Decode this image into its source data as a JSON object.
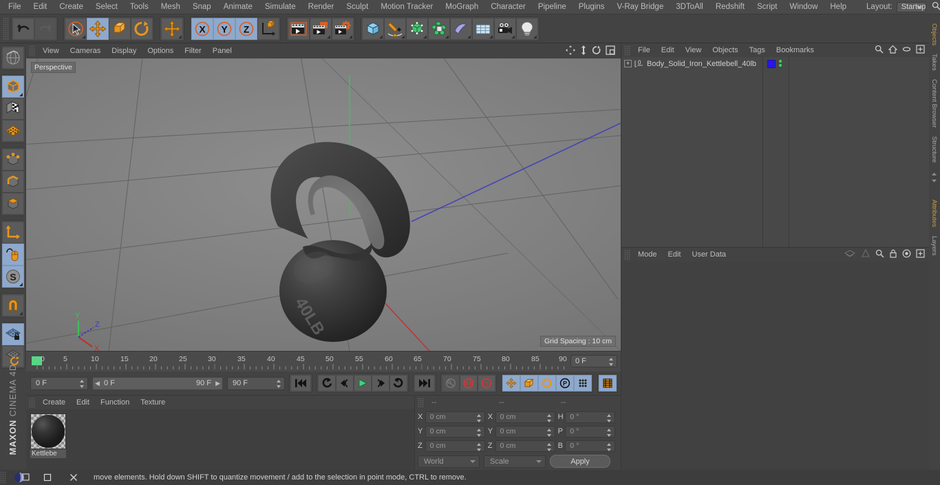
{
  "menubar": {
    "items": [
      "File",
      "Edit",
      "Create",
      "Select",
      "Tools",
      "Mesh",
      "Snap",
      "Animate",
      "Simulate",
      "Render",
      "Sculpt",
      "Motion Tracker",
      "MoGraph",
      "Character",
      "Pipeline",
      "Plugins",
      "V-Ray Bridge",
      "3DToAll",
      "Redshift",
      "Script",
      "Window",
      "Help"
    ],
    "layout_label": "Layout:",
    "layout_value": "Startup",
    "search_icon": "search-icon"
  },
  "toolbar": {
    "undo": "undo-icon",
    "redo": "redo-icon",
    "live_selection": "live-selection-icon",
    "move": "move-tool-icon",
    "scale": "scale-tool-icon",
    "rotate": "rotate-tool-icon",
    "move_alt": "move-axis-icon",
    "axis_x": "X",
    "axis_y": "Y",
    "axis_z": "Z",
    "world_axis": "world-coordinate-icon",
    "render_view": "render-view-icon",
    "render_picture_viewer": "render-picture-viewer-icon",
    "render_settings": "render-settings-icon",
    "cube": "primitive-cube-icon",
    "spline": "spline-pen-icon",
    "generator": "generator-icon",
    "deformer": "deformer-icon",
    "scene_object": "scene-object-icon",
    "scene_floor": "floor-icon",
    "camera": "camera-icon",
    "light": "light-icon"
  },
  "left_toolbar": {
    "items": [
      {
        "name": "make-editable-icon",
        "active": false
      },
      {
        "name": "model-mode-icon",
        "active": true
      },
      {
        "name": "texture-mode-icon",
        "active": false
      },
      {
        "name": "workplane-mode-icon",
        "active": false
      },
      {
        "name": "points-mode-icon",
        "active": false
      },
      {
        "name": "edges-mode-icon",
        "active": false
      },
      {
        "name": "polygons-mode-icon",
        "active": false
      },
      {
        "name": "axis-modify-icon",
        "active": false
      },
      {
        "name": "enable-animation-icon",
        "active": true
      },
      {
        "name": "snap-mode-icon",
        "active": true
      },
      {
        "name": "magnet-tool-icon",
        "active": false
      },
      {
        "name": "workplane-lock-icon",
        "active": true
      },
      {
        "name": "workplane-rotate-icon",
        "active": false
      }
    ],
    "brand_maxon": "MAXON",
    "brand_app": "CINEMA 4D"
  },
  "viewport": {
    "menu": [
      "View",
      "Cameras",
      "Display",
      "Options",
      "Filter",
      "Panel"
    ],
    "nav_icons": [
      "pan-icon",
      "dolly-icon",
      "rotate-icon",
      "maximize-viewport-icon"
    ],
    "perspective_label": "Perspective",
    "grid_spacing": "Grid Spacing : 10 cm",
    "axis_labels": {
      "x": "X",
      "y": "Y",
      "z": "Z"
    },
    "model_label": "40LB"
  },
  "timeline": {
    "ticks": [
      0,
      5,
      10,
      15,
      20,
      25,
      30,
      35,
      40,
      45,
      50,
      55,
      60,
      65,
      70,
      75,
      80,
      85,
      90
    ],
    "current_frame_field": "0 F"
  },
  "transport": {
    "current_frame": "0 F",
    "range_start": "0 F",
    "range_end": "90 F",
    "end_frame": "90 F",
    "buttons": [
      {
        "name": "go-to-start-button",
        "glyph": "first"
      },
      {
        "name": "previous-keyframe-button",
        "glyph": "prevkey"
      },
      {
        "name": "step-back-button",
        "glyph": "stepback"
      },
      {
        "name": "play-button",
        "glyph": "play"
      },
      {
        "name": "step-forward-button",
        "glyph": "stepfwd"
      },
      {
        "name": "next-keyframe-button",
        "glyph": "nextkey"
      },
      {
        "name": "go-to-end-button",
        "glyph": "last"
      }
    ],
    "record_tools": [
      {
        "name": "autokeying-button",
        "active": false
      },
      {
        "name": "record-active-objects-button",
        "active": false
      },
      {
        "name": "keyframe-selection-button",
        "active": false
      }
    ],
    "key_tools": [
      {
        "name": "position-key-button",
        "active": true
      },
      {
        "name": "scale-key-button",
        "active": true
      },
      {
        "name": "rotation-key-button",
        "active": true
      },
      {
        "name": "parameter-key-button",
        "active": true
      },
      {
        "name": "point-level-animation-button",
        "active": true
      },
      {
        "name": "timeline-toggle-button",
        "active": true
      }
    ]
  },
  "material_manager": {
    "menu": [
      "Create",
      "Edit",
      "Function",
      "Texture"
    ],
    "materials": [
      {
        "name": "Kettlebe",
        "swatch": "material-preview-sphere"
      }
    ]
  },
  "coordinates": {
    "headers": [
      "--",
      "--",
      "--"
    ],
    "rows": [
      {
        "pos_label": "X",
        "pos_value": "0 cm",
        "size_label": "X",
        "size_value": "0 cm",
        "rot_label": "H",
        "rot_value": "0 °"
      },
      {
        "pos_label": "Y",
        "pos_value": "0 cm",
        "size_label": "Y",
        "size_value": "0 cm",
        "rot_label": "P",
        "rot_value": "0 °"
      },
      {
        "pos_label": "Z",
        "pos_value": "0 cm",
        "size_label": "Z",
        "size_value": "0 cm",
        "rot_label": "B",
        "rot_value": "0 °"
      }
    ],
    "system": "World",
    "mode": "Scale",
    "apply": "Apply"
  },
  "object_manager": {
    "menu": [
      "File",
      "Edit",
      "View",
      "Objects",
      "Tags",
      "Bookmarks"
    ],
    "tools": [
      "search-icon",
      "home-icon",
      "ellipse-icon",
      "plus-box-icon"
    ],
    "objects": [
      {
        "name": "Body_Solid_Iron_Kettlebell_40lb",
        "icon": "polygon-object-icon",
        "tag_color": "#2a16e8"
      }
    ],
    "tab_label": "Objects"
  },
  "attributes_manager": {
    "menu": [
      "Mode",
      "Edit",
      "User Data"
    ],
    "tools": [
      "layers-icon",
      "cone-icon",
      "search-icon",
      "lock-icon",
      "target-icon",
      "plus-box-icon"
    ],
    "tab_label": "Attributes"
  },
  "right_tabs": [
    "Objects",
    "Takes",
    "Content Browser",
    "Structure",
    "Attributes",
    "Layers"
  ],
  "statusbar": {
    "text": "move elements. Hold down SHIFT to quantize movement / add to the selection in point mode, CTRL to remove.",
    "window_buttons": [
      "app-icon",
      "minimize-button",
      "close-button"
    ]
  },
  "colors": {
    "accent_blue": "#8fa9cc",
    "orange": "#e08a20",
    "green": "#3fd463",
    "red": "#c73b3b",
    "tag_blue": "#2a16e8"
  }
}
